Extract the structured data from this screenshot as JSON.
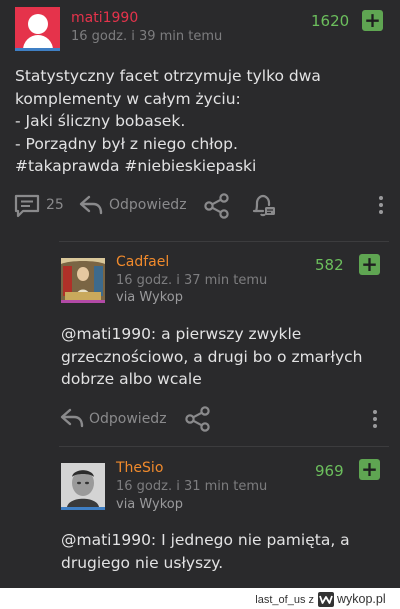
{
  "post": {
    "username": "mati1990",
    "timestamp": "16 godz. i 39 min temu",
    "score": "1620",
    "plus": "+",
    "text": "Statystyczny facet otrzymuje tylko dwa\nkomplementy w całym życiu:\n- Jaki śliczny bobasek.\n- Porządny był z niego chłop.\n#takaprawda #niebieskiepaski",
    "comment_count": "25",
    "reply_label": "Odpowiedz"
  },
  "comments": [
    {
      "username": "Cadfael",
      "timestamp": "16 godz. i 37 min temu",
      "via": "via Wykop",
      "score": "582",
      "text": "@mati1990: a pierwszy zwykle\ngrzecznościowo, a drugi bo o zmarłych\ndobrze albo wcale",
      "reply_label": "Odpowiedz"
    },
    {
      "username": "TheSio",
      "timestamp": "16 godz. i 31 min temu",
      "via": "via Wykop",
      "score": "969",
      "text": "@mati1990: I jednego nie pamięta, a\ndrugiego nie usłyszy."
    }
  ],
  "footer": {
    "author": "last_of_us  z",
    "site": "wykop.pl"
  },
  "colors": {
    "background": "#2a2a2c",
    "username_red": "#e5334b",
    "username_orange": "#f08a2c",
    "score_green": "#6cbf5d",
    "plus_green": "#5fa552"
  }
}
